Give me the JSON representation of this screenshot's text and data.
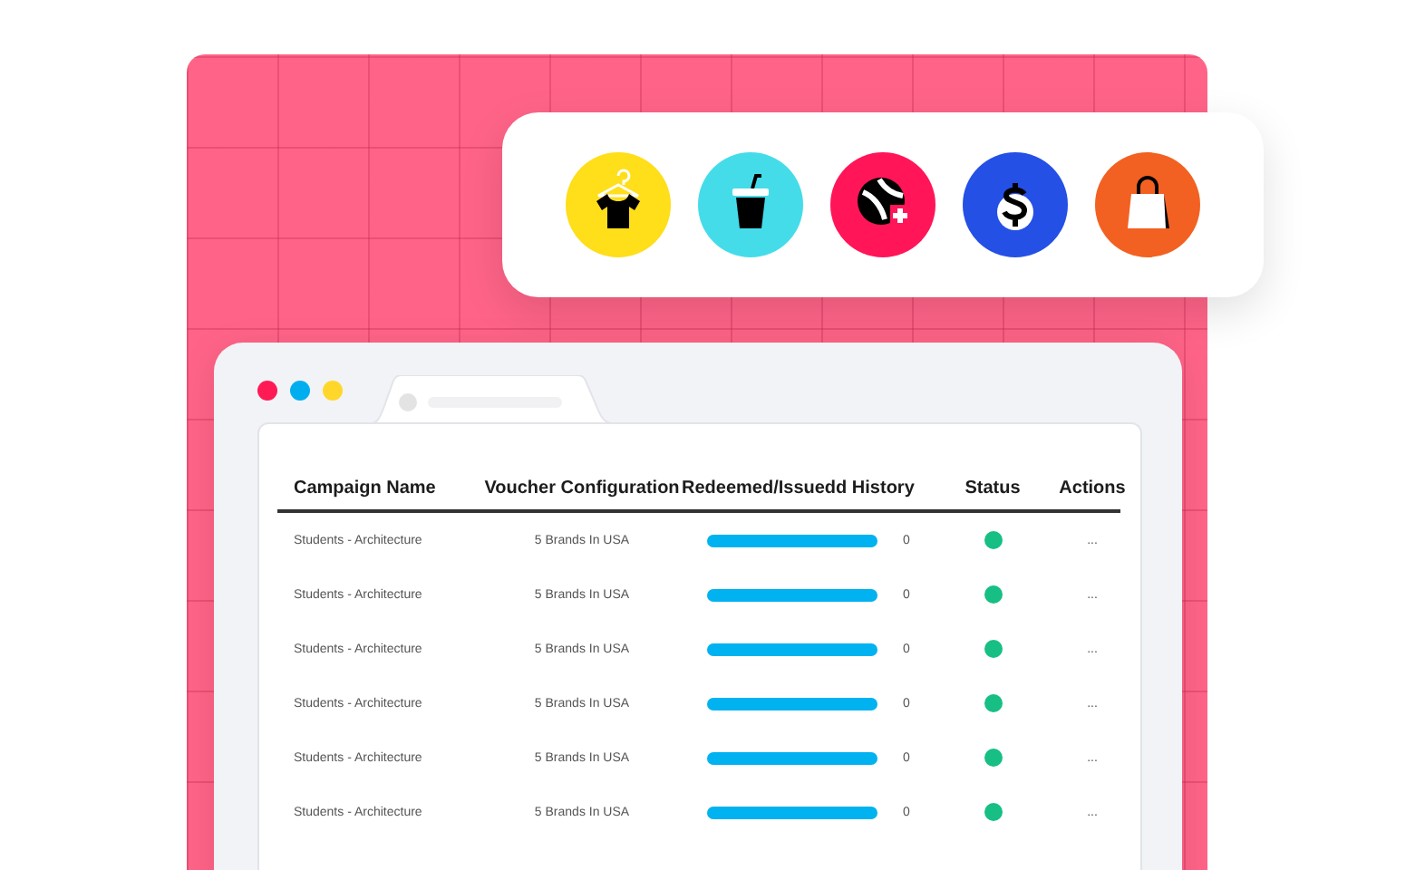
{
  "table": {
    "columns": [
      "Campaign Name",
      "Voucher Configuration",
      "Redeemed/Issuedd History",
      "Status",
      "Actions"
    ],
    "rows": [
      {
        "campaign": "Students - Architecture",
        "voucher": "5 Brands In USA",
        "level": 1,
        "count": "0",
        "active": true,
        "actions": "..."
      },
      {
        "campaign": "Students - Architecture",
        "voucher": "5 Brands In USA",
        "level": 1,
        "count": "0",
        "active": true,
        "actions": "..."
      },
      {
        "campaign": "Students - Architecture",
        "voucher": "5 Brands In USA",
        "level": 1,
        "count": "0",
        "active": true,
        "actions": "..."
      },
      {
        "campaign": "Students - Architecture",
        "voucher": "5 Brands In USA",
        "level": 1,
        "count": "0",
        "active": true,
        "actions": "..."
      },
      {
        "campaign": "Students - Architecture",
        "voucher": "5 Brands In USA",
        "level": 1,
        "count": "0",
        "active": true,
        "actions": "..."
      },
      {
        "campaign": "Students - Architecture",
        "voucher": "5 Brands In USA",
        "level": 1,
        "count": "0",
        "active": true,
        "actions": "..."
      }
    ]
  }
}
